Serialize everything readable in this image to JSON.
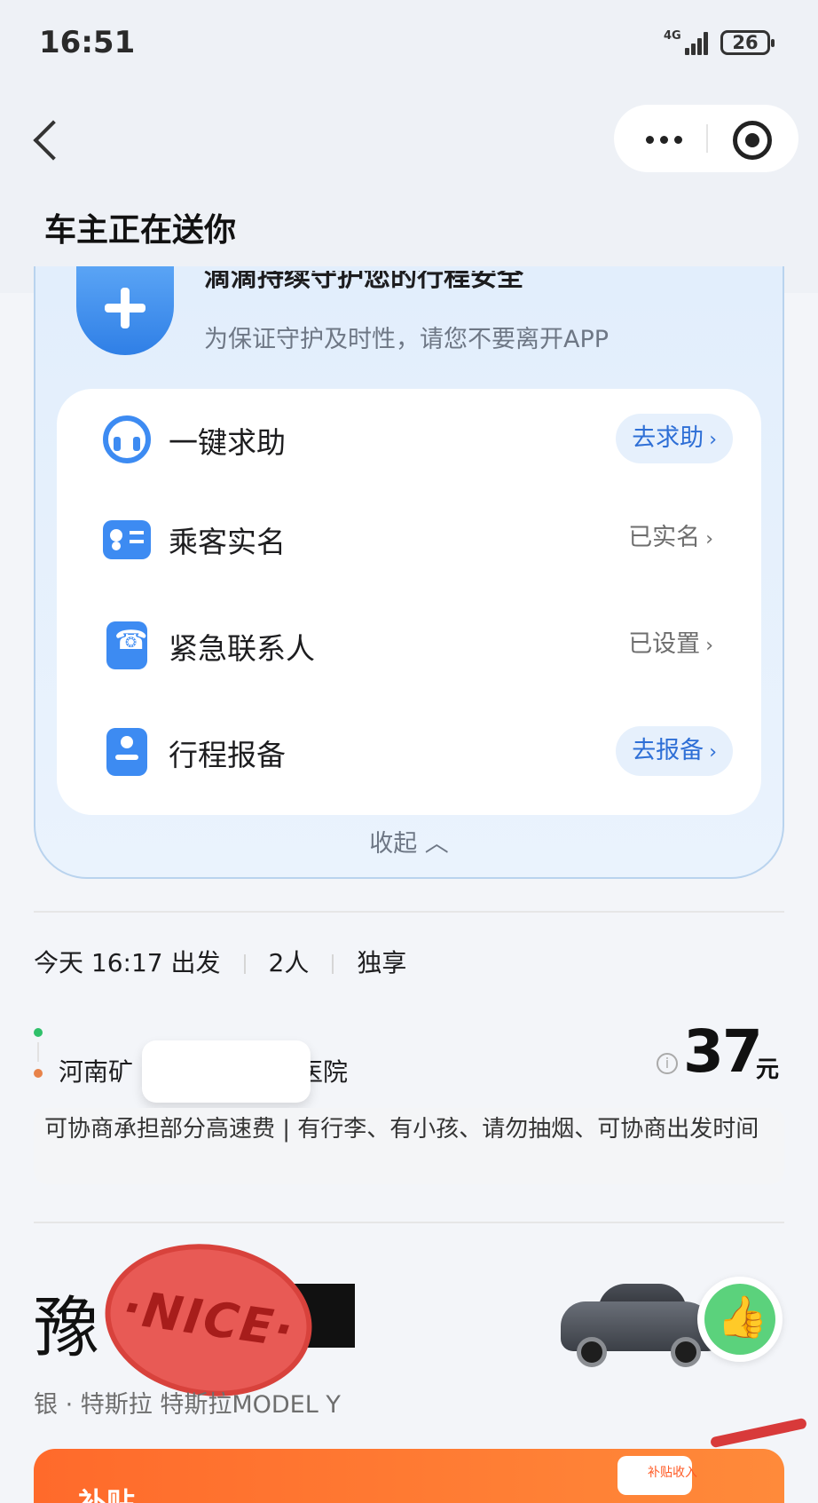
{
  "status_bar": {
    "time": "16:51",
    "network": "4G",
    "battery": "26"
  },
  "nav": {
    "title": "车主正在送你"
  },
  "safety": {
    "headline": "滴滴持续守护您的行程安全",
    "subtitle": "为保证守护及时性，请您不要离开APP",
    "items": [
      {
        "label": "一键求助",
        "action": "去求助",
        "icon": "headset-icon"
      },
      {
        "label": "乘客实名",
        "status": "已实名",
        "icon": "id-card-icon"
      },
      {
        "label": "紧急联系人",
        "status": "已设置",
        "icon": "phone-icon"
      },
      {
        "label": "行程报备",
        "action": "去报备",
        "icon": "report-icon"
      }
    ],
    "collapse_label": "收起"
  },
  "trip": {
    "departure": "今天 16:17 出发",
    "passengers": "2人",
    "mode": "独享",
    "destination_prefix": "河南矿",
    "destination_suffix": "医院",
    "price": "37",
    "price_unit": "元",
    "note": "可协商承担部分高速费 | 有行李、有小孩、请勿抽烟、可协商出发时间"
  },
  "car": {
    "plate_prefix": "豫",
    "sticker_text": "·NICE·",
    "description": "银 · 特斯拉 特斯拉MODEL Y"
  },
  "banner": {
    "text": "补贴",
    "tag": "补贴收入"
  },
  "colors": {
    "accent": "#3d8bf2",
    "link": "#2e6fd6",
    "start_dot": "#2fc06a",
    "end_dot": "#e8834a",
    "banner": "#ff6a2b"
  }
}
